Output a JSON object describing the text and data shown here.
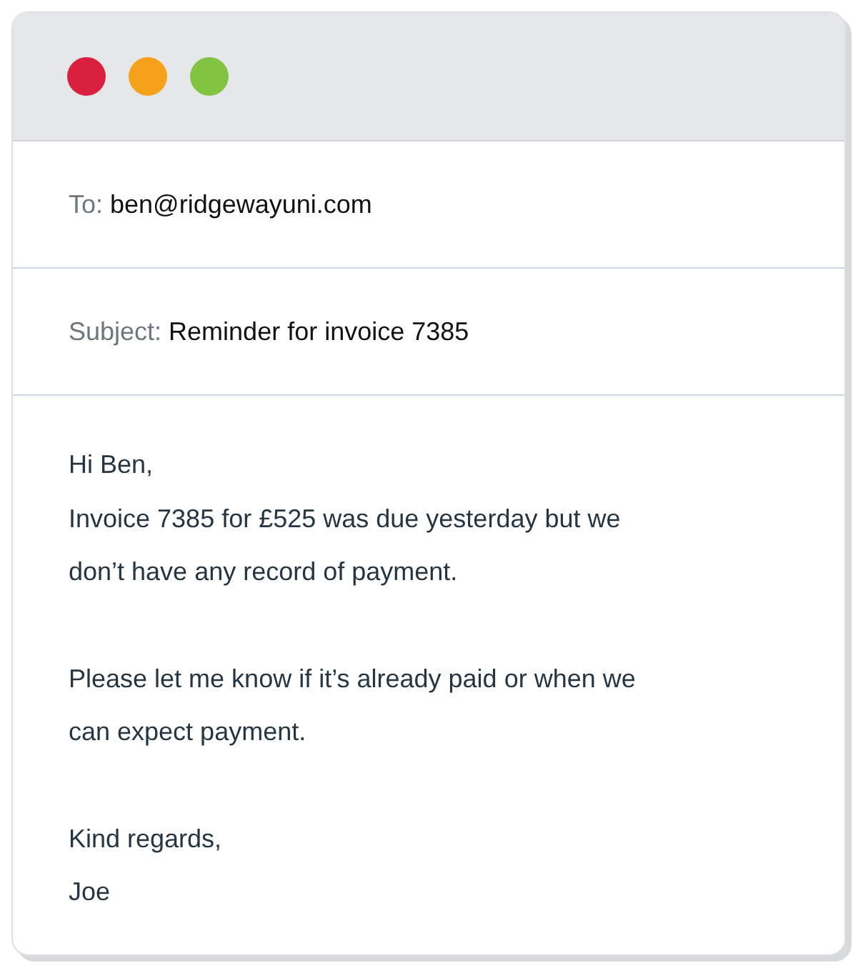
{
  "window": {
    "controls": [
      {
        "color": "#d9213f"
      },
      {
        "color": "#f5a11c"
      },
      {
        "color": "#82c341"
      }
    ]
  },
  "fields": [
    {
      "label": "To:",
      "value": "ben@ridgewayuni.com"
    },
    {
      "label": "Subject:",
      "value": "Reminder for invoice 7385"
    }
  ],
  "body": {
    "paragraphs": [
      [
        "Hi Ben,",
        "Invoice 7385 for £525 was due yesterday but we",
        "don’t have any record of payment."
      ],
      [
        "Please let me know if it’s already paid or when we",
        "can expect payment."
      ],
      [
        "Kind regards,",
        "Joe"
      ]
    ]
  }
}
